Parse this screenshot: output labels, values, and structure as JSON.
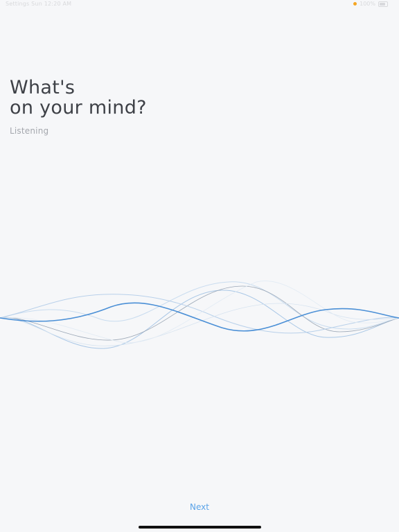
{
  "status_bar": {
    "left_text": "Settings  Sun 12:20 AM",
    "right_text": "100%"
  },
  "heading": {
    "line1": "What's",
    "line2": "on your mind?"
  },
  "status": {
    "label": "Listening"
  },
  "actions": {
    "next_label": "Next"
  },
  "colors": {
    "background": "#f6f7f9",
    "accent": "#5aa3e8",
    "wave_primary": "#4a8fd6",
    "heading": "#3e4147"
  }
}
